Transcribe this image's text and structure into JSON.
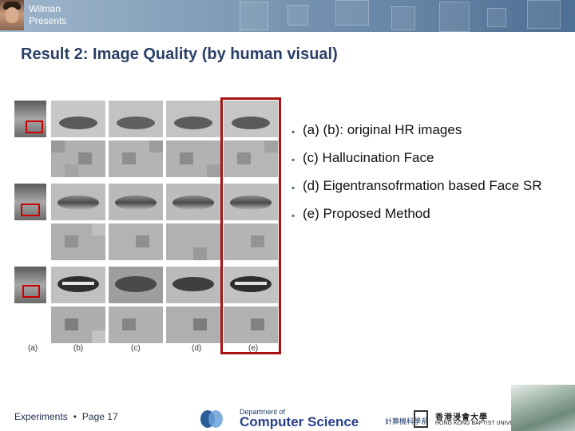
{
  "header": {
    "presenter_line1": "Wilman",
    "presenter_line2": "Presents"
  },
  "slide": {
    "title": "Result 2: Image Quality (by human visual)"
  },
  "figure": {
    "column_labels": [
      "(a)",
      "(b)",
      "(c)",
      "(d)",
      "(e)"
    ]
  },
  "bullets": [
    "(a) (b): original HR images",
    "(c) Hallucination Face",
    "(d) Eigentransofrmation based Face SR",
    "(e) Proposed Method"
  ],
  "footer": {
    "section": "Experiments",
    "page": "Page 17",
    "dept_small": "Department of",
    "dept_big": "Computer Science",
    "cn_dept": "計算機科學系",
    "university_cn": "香港浸會大學",
    "university_en": "HONG KONG BAPTIST UNIVERSITY"
  }
}
